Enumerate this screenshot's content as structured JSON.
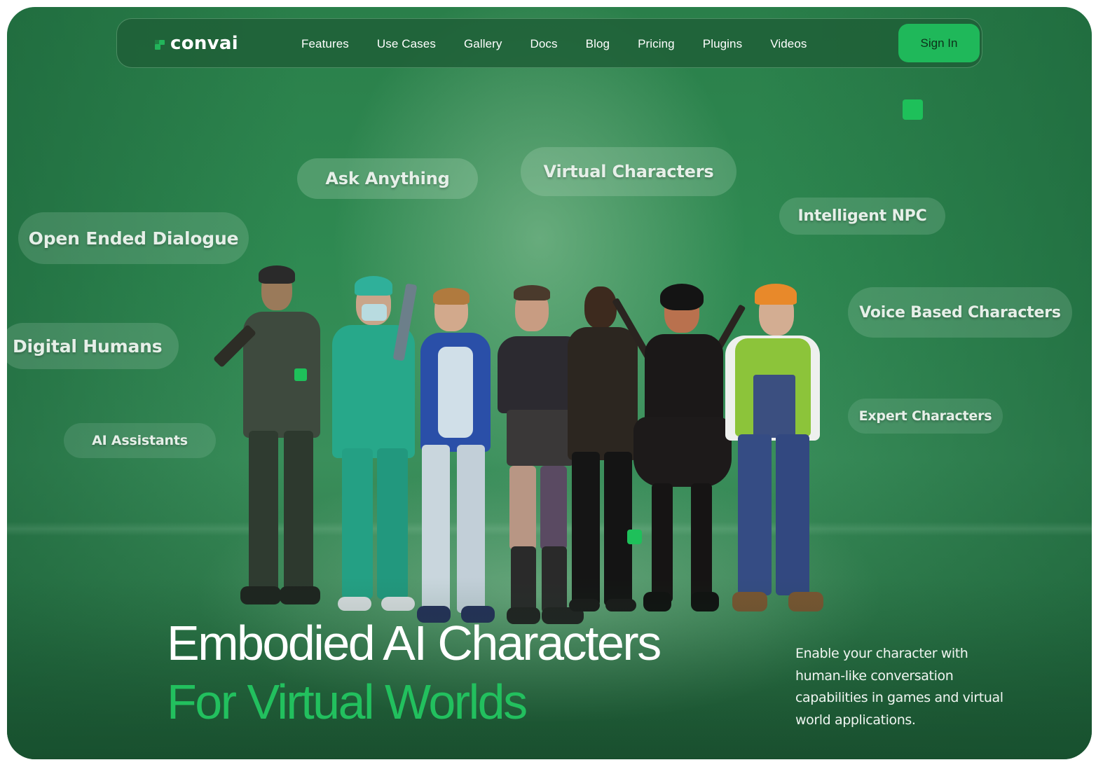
{
  "brand": {
    "name": "convai",
    "accent_color": "#22c05e"
  },
  "nav": {
    "links": [
      {
        "label": "Features"
      },
      {
        "label": "Use Cases"
      },
      {
        "label": "Gallery"
      },
      {
        "label": "Docs"
      },
      {
        "label": "Blog"
      },
      {
        "label": "Pricing"
      },
      {
        "label": "Plugins"
      },
      {
        "label": "Videos"
      }
    ],
    "sign_in_label": "Sign In"
  },
  "hero": {
    "tags": [
      {
        "label": "Ask Anything"
      },
      {
        "label": "Virtual Characters"
      },
      {
        "label": "Intelligent NPC"
      },
      {
        "label": "Open Ended Dialogue"
      },
      {
        "label": "Digital Humans"
      },
      {
        "label": "Voice Based Characters"
      },
      {
        "label": "AI Assistants"
      },
      {
        "label": "Expert Characters"
      }
    ],
    "characters": [
      {
        "role": "armored warrior"
      },
      {
        "role": "medical scrubs"
      },
      {
        "role": "sci-fi suit"
      },
      {
        "role": "punk outfit"
      },
      {
        "role": "casual shirt"
      },
      {
        "role": "ninja dress"
      },
      {
        "role": "construction worker"
      }
    ],
    "headline_line1": "Embodied AI Characters",
    "headline_line2": "For Virtual Worlds",
    "description": "Enable your character with human-like conversation capabilities in games and virtual world applications."
  }
}
